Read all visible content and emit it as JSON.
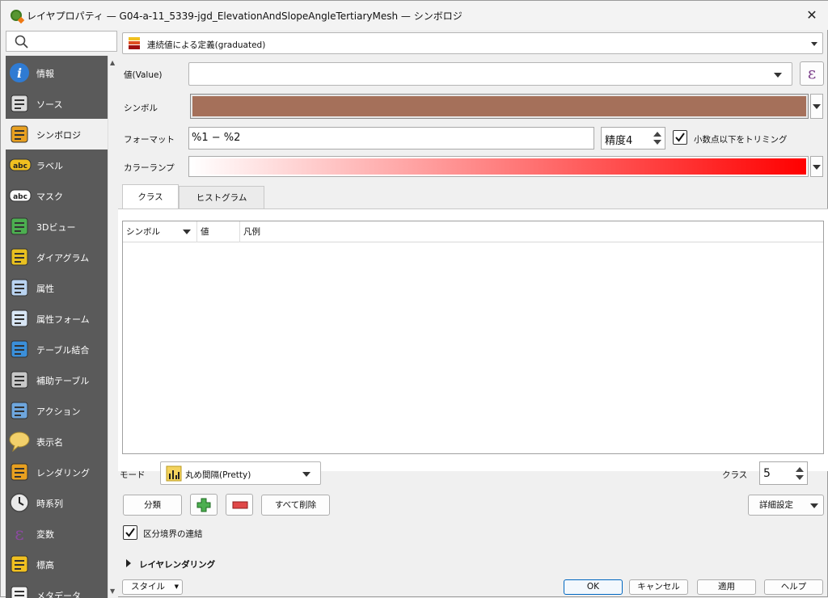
{
  "window": {
    "title": "レイヤプロパティ — G04-a-11_5339-jgd_ElevationAndSlopeAngleTertiaryMesh — シンボロジ",
    "close_glyph": "✕"
  },
  "sidebar": {
    "items": [
      {
        "label": "情報",
        "icon": "info-icon"
      },
      {
        "label": "ソース",
        "icon": "source-icon"
      },
      {
        "label": "シンボロジ",
        "icon": "symbology-icon"
      },
      {
        "label": "ラベル",
        "icon": "labels-icon"
      },
      {
        "label": "マスク",
        "icon": "mask-icon"
      },
      {
        "label": "3Dビュー",
        "icon": "3d-view-icon"
      },
      {
        "label": "ダイアグラム",
        "icon": "diagram-icon"
      },
      {
        "label": "属性",
        "icon": "attributes-icon"
      },
      {
        "label": "属性フォーム",
        "icon": "attributes-form-icon"
      },
      {
        "label": "テーブル結合",
        "icon": "joins-icon"
      },
      {
        "label": "補助テーブル",
        "icon": "auxiliary-storage-icon"
      },
      {
        "label": "アクション",
        "icon": "actions-icon"
      },
      {
        "label": "表示名",
        "icon": "display-icon"
      },
      {
        "label": "レンダリング",
        "icon": "rendering-icon"
      },
      {
        "label": "時系列",
        "icon": "temporal-icon"
      },
      {
        "label": "変数",
        "icon": "variables-icon"
      },
      {
        "label": "標高",
        "icon": "elevation-icon"
      },
      {
        "label": "メタデータ",
        "icon": "metadata-icon"
      }
    ],
    "active_index": 2
  },
  "renderer": {
    "selected": "連続値による定義(graduated)"
  },
  "value_row": {
    "label": "値(Value)",
    "value": "",
    "expr_glyph": "ε"
  },
  "symbol_row": {
    "label": "シンボル",
    "color": "#a5705a"
  },
  "format_row": {
    "label": "フォーマット",
    "value": "%1 − %2",
    "precision": "精度4",
    "trim_label": "小数点以下をトリミング",
    "trim_checked": true
  },
  "ramp_row": {
    "label": "カラーランプ",
    "start_color": "#ffffff",
    "end_color": "#ff0000"
  },
  "tabs": [
    {
      "label": "クラス",
      "active": true
    },
    {
      "label": "ヒストグラム",
      "active": false
    }
  ],
  "table": {
    "columns": [
      "シンボル",
      "値",
      "凡例"
    ],
    "rows": []
  },
  "mode": {
    "label": "モード",
    "value": "丸め間隔(Pretty)"
  },
  "classes": {
    "label": "クラス",
    "value": "5"
  },
  "buttons": {
    "classify": "分類",
    "add_glyph": "+",
    "remove_glyph": "−",
    "delete_all": "すべて削除",
    "advanced": "詳細設定"
  },
  "link_boundaries": {
    "label": "区分境界の連結",
    "checked": true
  },
  "layer_rendering": {
    "label": "レイヤレンダリング"
  },
  "footer": {
    "style": "スタイル",
    "ok": "OK",
    "cancel": "キャンセル",
    "apply": "適用",
    "help": "ヘルプ"
  }
}
